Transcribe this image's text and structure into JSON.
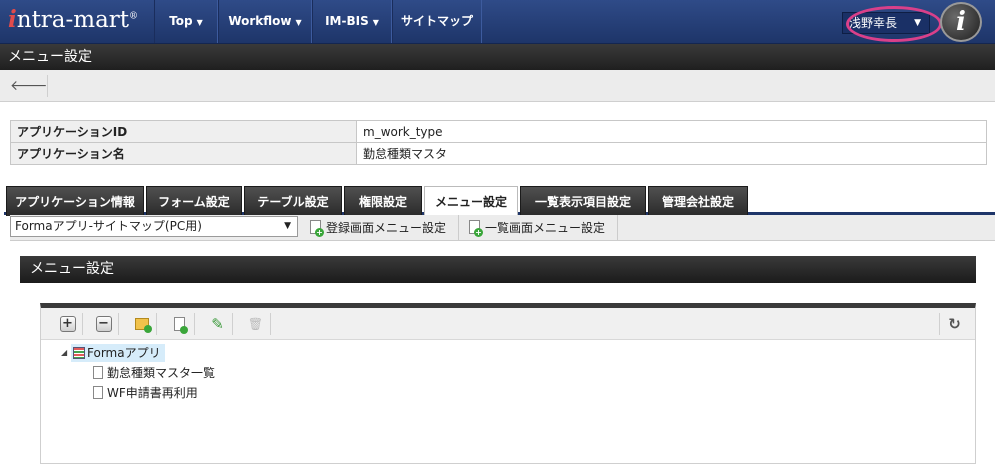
{
  "app": {
    "logo": "intra-mart",
    "logo_mark": "®"
  },
  "nav": {
    "items": [
      {
        "label": "Top",
        "has_caret": true
      },
      {
        "label": "Workflow",
        "has_caret": true
      },
      {
        "label": "IM-BIS",
        "has_caret": true
      },
      {
        "label": "サイトマップ",
        "has_caret": false
      }
    ],
    "user_name": "浅野幸長",
    "info_glyph": "i"
  },
  "page": {
    "title": "メニュー設定",
    "back_icon": "arrow-left-icon"
  },
  "info_table": [
    {
      "key": "アプリケーションID",
      "value": "m_work_type"
    },
    {
      "key": "アプリケーション名",
      "value": "勤怠種類マスタ"
    }
  ],
  "tabs": [
    {
      "label": "アプリケーション情報",
      "active": false
    },
    {
      "label": "フォーム設定",
      "active": false
    },
    {
      "label": "テーブル設定",
      "active": false
    },
    {
      "label": "権限設定",
      "active": false
    },
    {
      "label": "メニュー設定",
      "active": true
    },
    {
      "label": "一覧表示項目設定",
      "active": false
    },
    {
      "label": "管理会社設定",
      "active": false
    }
  ],
  "toolbar": {
    "site_select_value": "Formaアプリ-サイトマップ(PC用)",
    "register_menu_label": "登録画面メニュー設定",
    "list_menu_label": "一覧画面メニュー設定"
  },
  "menu_section": {
    "title": "メニュー設定"
  },
  "tree": {
    "toolbar_buttons": [
      {
        "name": "expand-all-button",
        "icon": "plus-square-icon",
        "glyph": "+"
      },
      {
        "name": "collapse-all-button",
        "icon": "minus-square-icon",
        "glyph": "−"
      },
      {
        "name": "add-folder-button",
        "icon": "folder-add-icon",
        "glyph": ""
      },
      {
        "name": "add-item-button",
        "icon": "document-add-icon",
        "glyph": ""
      },
      {
        "name": "edit-button",
        "icon": "pencil-icon",
        "glyph": "✎"
      },
      {
        "name": "delete-button",
        "icon": "trash-icon",
        "glyph": "🗑"
      }
    ],
    "refresh_icon": "refresh-icon",
    "refresh_glyph": "↻",
    "root": {
      "label": "Formaアプリ",
      "children": [
        "勤怠種類マスタ一覧",
        "WF申請書再利用"
      ]
    }
  },
  "colors": {
    "nav_bg": "#1e3569",
    "user_highlight": "#d9408a",
    "selected_node": "#d6ecfa"
  }
}
